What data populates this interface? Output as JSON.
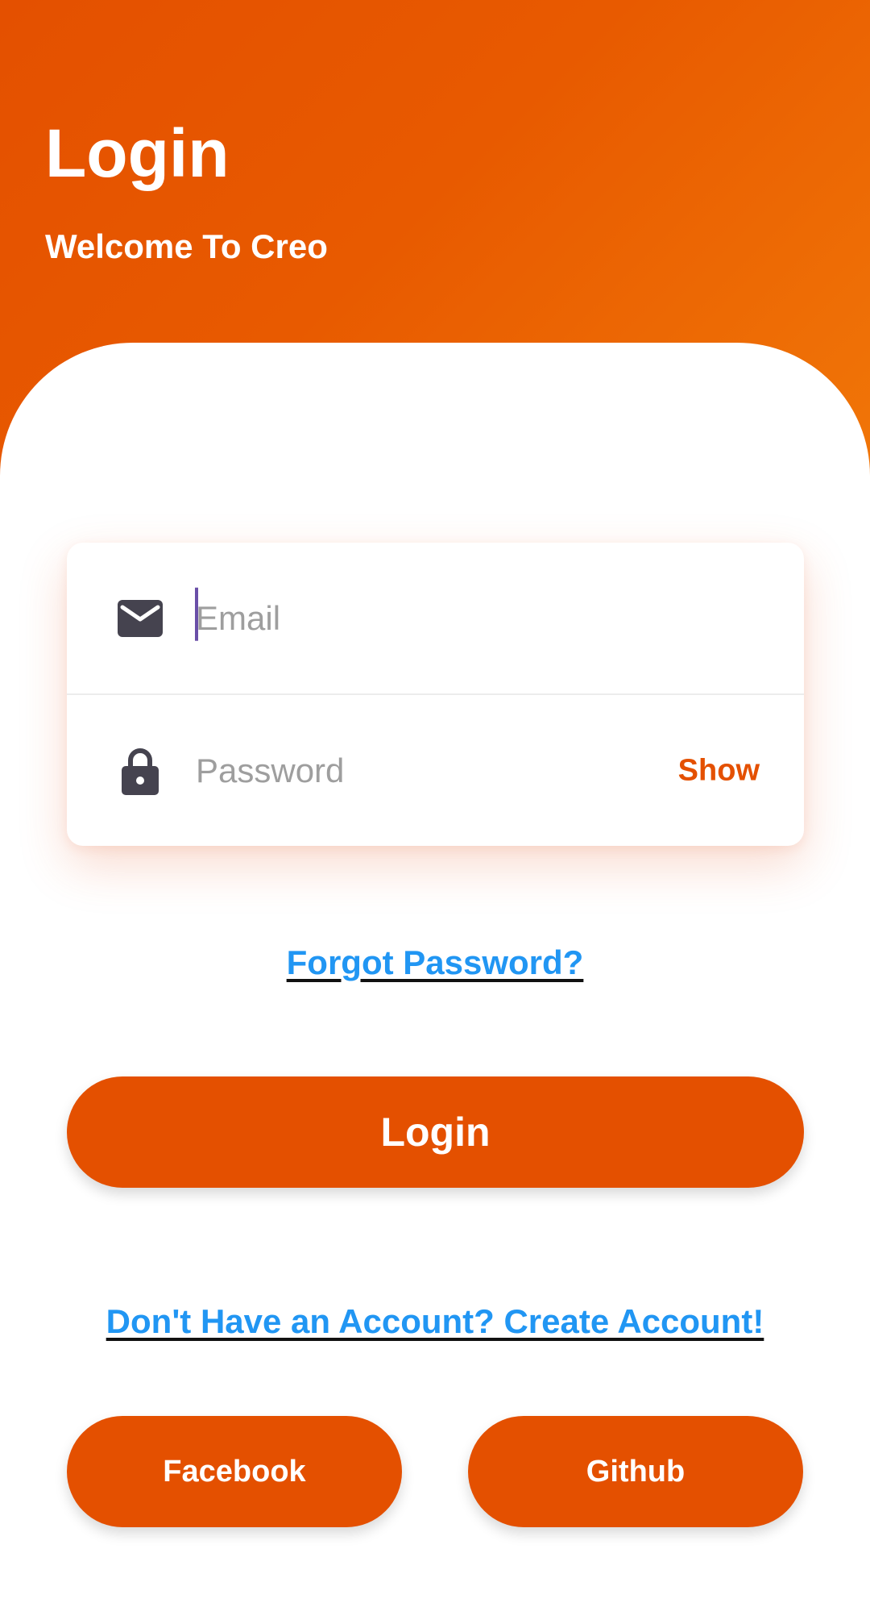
{
  "header": {
    "title": "Login",
    "subtitle": "Welcome To Creo"
  },
  "form": {
    "email": {
      "icon": "mail-icon",
      "value": "",
      "placeholder": "Email"
    },
    "password": {
      "icon": "lock-icon",
      "value": "",
      "placeholder": "Password",
      "toggle_label": "Show"
    }
  },
  "links": {
    "forgot_password": "Forgot Password?",
    "create_account": "Don't Have an Account? Create Account!"
  },
  "buttons": {
    "login": "Login",
    "facebook": "Facebook",
    "github": "Github"
  },
  "colors": {
    "accent": "#e45000",
    "gradient_end": "#f17708",
    "link": "#2196f3",
    "icon": "#45434f",
    "placeholder": "#9e9e9e"
  }
}
